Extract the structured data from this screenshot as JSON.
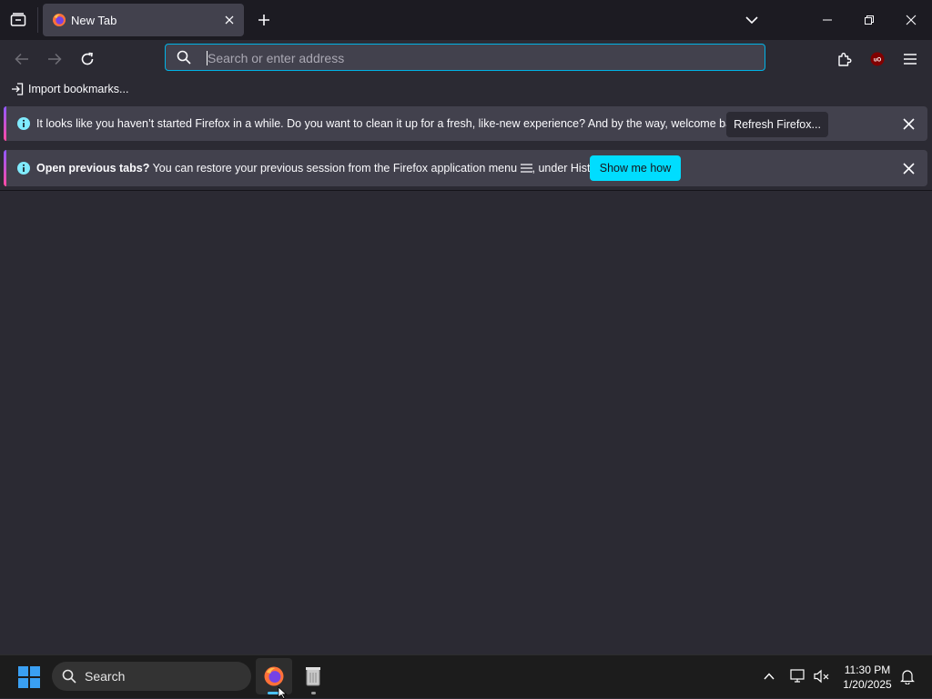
{
  "tabs": [
    {
      "title": "New Tab",
      "active": true
    }
  ],
  "urlbar": {
    "placeholder": "Search or enter address",
    "value": ""
  },
  "bookmarks_toolbar": {
    "import_label": "Import bookmarks..."
  },
  "notifications": [
    {
      "icon": "info-icon",
      "message": "It looks like you haven’t started Firefox in a while. Do you want to clean it up for a fresh, like-new experience? And by the way, welcome back!",
      "button_label": "Refresh Firefox..."
    },
    {
      "icon": "info-icon",
      "message_bold": "Open previous tabs?",
      "message_part1": " You can restore your previous session from the Firefox application menu ",
      "message_part2": ", under History.",
      "button_label": "Show me how"
    }
  ],
  "taskbar": {
    "search_label": "Search",
    "time": "11:30 PM",
    "date": "1/20/2025"
  },
  "colors": {
    "accent": "#00ddff",
    "focus_ring": "#00b3e6",
    "toolbar_bg": "#2b2a33",
    "tabbar_bg": "#1c1b22",
    "ublock_red": "#800000"
  }
}
